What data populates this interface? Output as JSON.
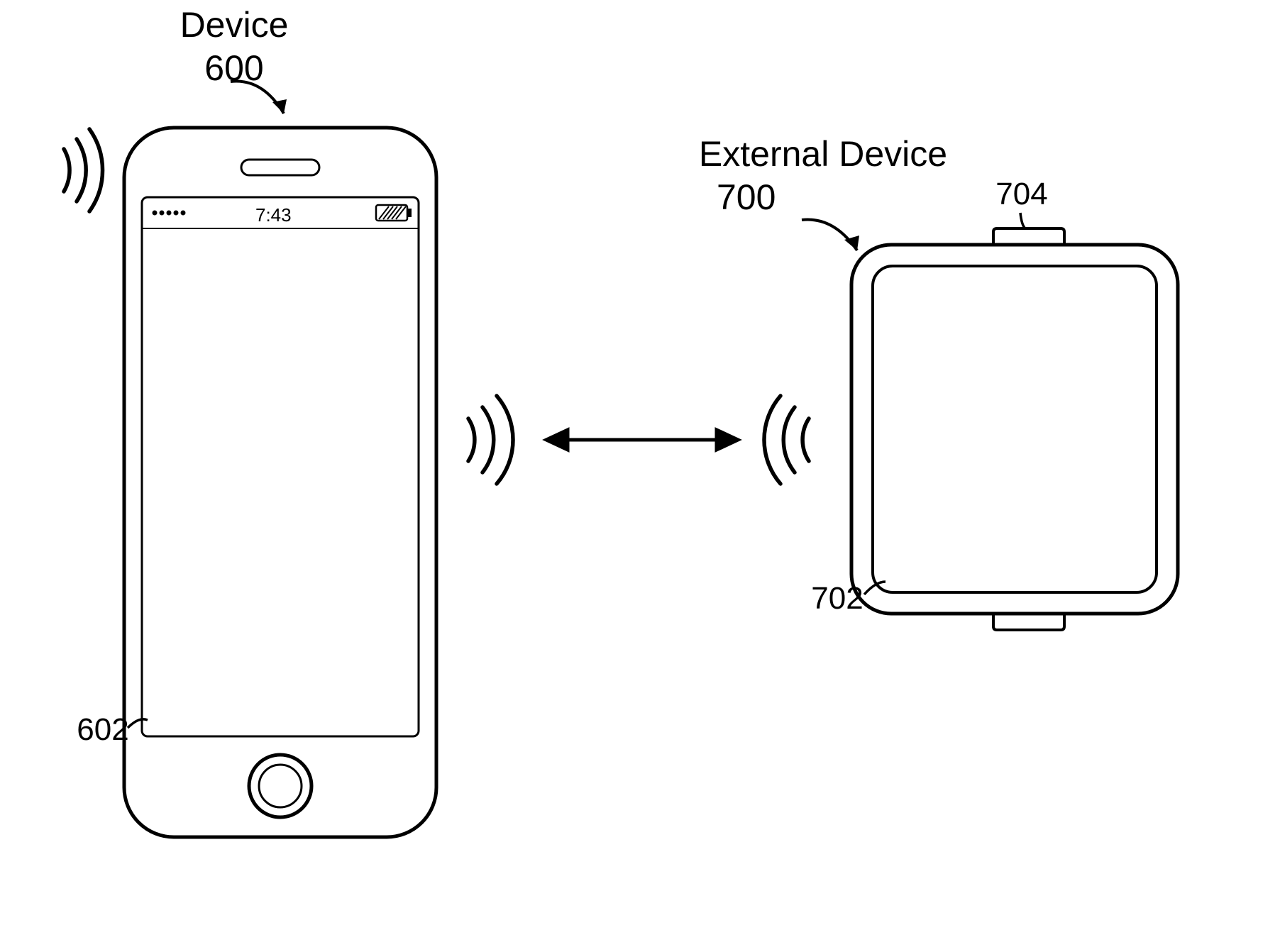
{
  "device": {
    "label": "Device",
    "ref": "600",
    "screen_ref": "602",
    "statusbar": {
      "time": "7:43"
    }
  },
  "external_device": {
    "label": "External Device",
    "ref": "700",
    "screen_ref": "702",
    "button_ref": "704"
  }
}
